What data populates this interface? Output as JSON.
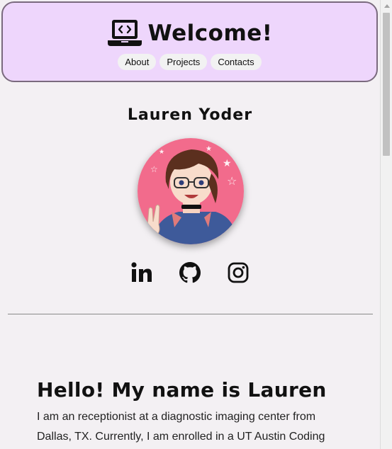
{
  "header": {
    "title": "Welcome!",
    "logo_icon": "laptop-code-icon",
    "nav": [
      {
        "label": "About"
      },
      {
        "label": "Projects"
      },
      {
        "label": "Contacts"
      }
    ],
    "background_color": "#eed6fc"
  },
  "profile": {
    "name": "Lauren Yoder",
    "avatar": "cartoon-avatar-image",
    "social": [
      {
        "icon": "linkedin-icon"
      },
      {
        "icon": "github-icon"
      },
      {
        "icon": "instagram-icon"
      }
    ]
  },
  "about": {
    "heading": "Hello! My name is Lauren",
    "bio": "I am an receptionist at a diagnostic imaging center from Dallas, TX. Currently, I am enrolled in a UT Austin Coding"
  }
}
